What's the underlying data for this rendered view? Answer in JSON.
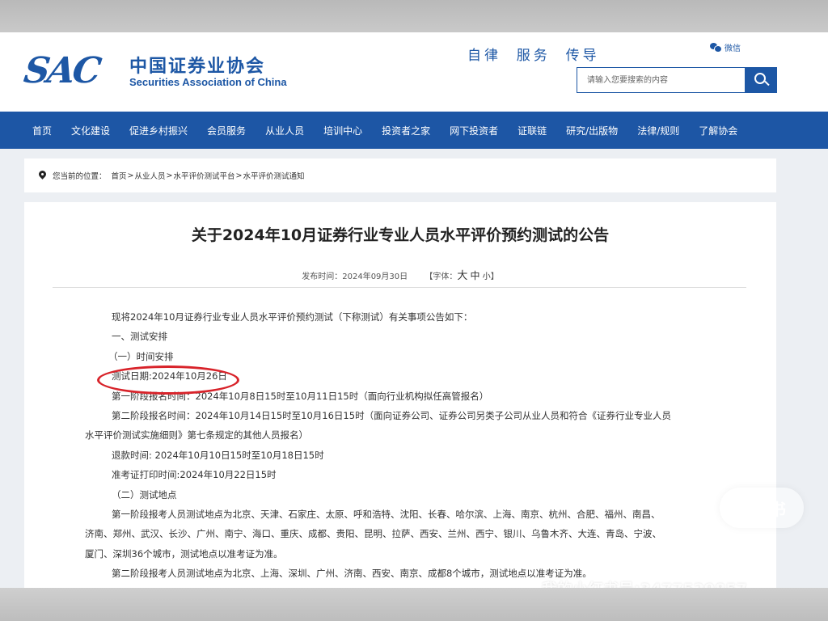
{
  "header": {
    "logo_sac": "SAC",
    "logo_cn": "中国证券业协会",
    "logo_en": "Securities Association of China",
    "slogan": "自律  服务  传导",
    "wechat_label": "微信",
    "search_placeholder": "请输入您要搜索的内容",
    "search_icon": "search-icon"
  },
  "nav": {
    "items": [
      "首页",
      "文化建设",
      "促进乡村振兴",
      "会员服务",
      "从业人员",
      "培训中心",
      "投资者之家",
      "网下投资者",
      "证联链",
      "研究/出版物",
      "法律/规则",
      "了解协会"
    ]
  },
  "breadcrumb": {
    "prefix": "您当前的位置：",
    "items": [
      "首页",
      "从业人员",
      "水平评价测试平台",
      "水平评价测试通知"
    ],
    "separator": ">"
  },
  "article": {
    "title": "关于2024年10月证券行业专业人员水平评价预约测试的公告",
    "publish_label": "发布时间：2024年09月30日",
    "font_label_open": "【字体：",
    "font_big": "大",
    "font_mid": "中",
    "font_small": "小",
    "font_label_close": "】",
    "paragraphs": [
      "现将2024年10月证券行业专业人员水平评价预约测试（下称测试）有关事项公告如下：",
      "一、测试安排",
      "（一）时间安排",
      "测试日期:2024年10月26日",
      "第一阶段报名时间：2024年10月8日15时至10月11日15时（面向行业机构拟任高管报名）",
      "第二阶段报名时间：2024年10月14日15时至10月16日15时（面向证券公司、证券公司另类子公司从业人员和符合《证券行业专业人员",
      "水平评价测试实施细则》第七条规定的其他人员报名）",
      "退款时间: 2024年10月10日15时至10月18日15时",
      "准考证打印时间:2024年10月22日15时",
      "（二）测试地点",
      "第一阶段报考人员测试地点为北京、天津、石家庄、太原、呼和浩特、沈阳、长春、哈尔滨、上海、南京、杭州、合肥、福州、南昌、",
      "济南、郑州、武汉、长沙、广州、南宁、海口、重庆、成都、贵阳、昆明、拉萨、西安、兰州、西宁、银川、乌鲁木齐、大连、青岛、宁波、",
      "厦门、深圳36个城市，测试地点以准考证为准。",
      "第二阶段报考人员测试地点为北京、上海、深圳、广州、济南、西安、南京、成都8个城市，测试地点以准考证为准。"
    ]
  },
  "watermark": {
    "badge": "小红书",
    "text": "我的小红书号:3477529857"
  },
  "colors": {
    "brand_blue": "#1d56a5",
    "highlight_red": "#d8232a"
  }
}
